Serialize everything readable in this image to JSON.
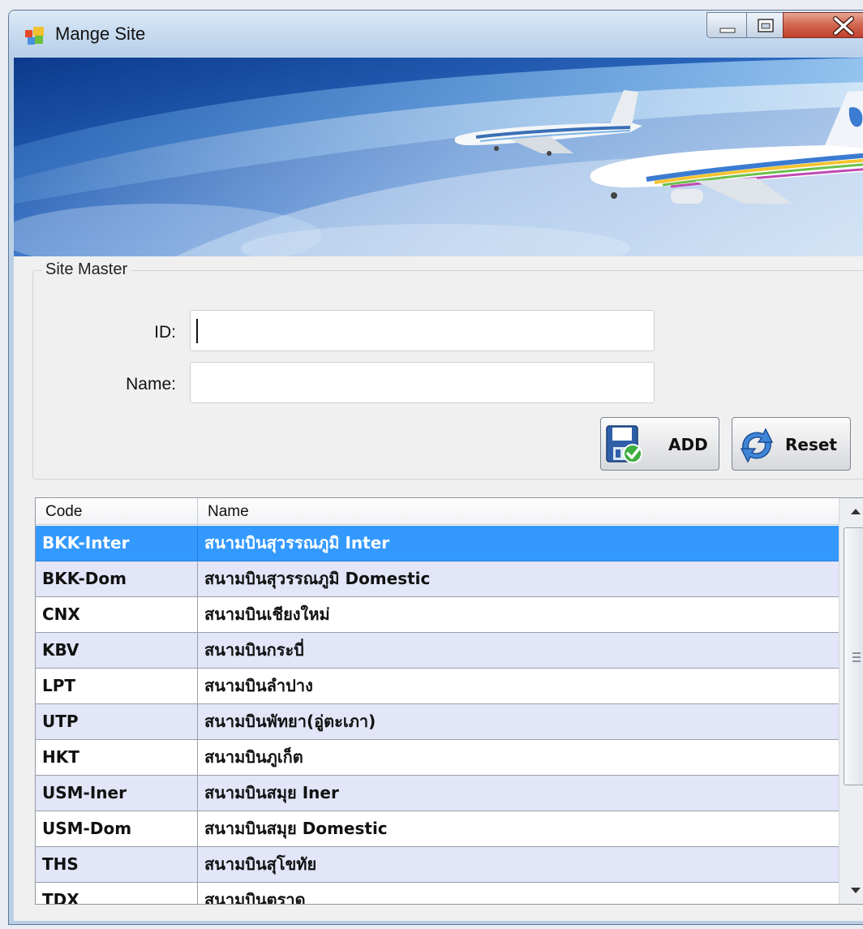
{
  "window": {
    "title": "Mange Site",
    "controls": {
      "minimize": "minimize",
      "maximize": "maximize",
      "close": "close"
    }
  },
  "banner": {
    "image": "airline-banner-two-airplanes"
  },
  "site_master": {
    "group_title": "Site Master",
    "id_label": "ID:",
    "id_value": "",
    "name_label": "Name:",
    "name_value": "",
    "add_label": "ADD",
    "reset_label": "Reset"
  },
  "grid": {
    "columns": [
      "Code",
      "Name"
    ],
    "rows": [
      {
        "code": "BKK-Inter",
        "name": "สนามบินสุวรรณภูมิ Inter"
      },
      {
        "code": "BKK-Dom",
        "name": "สนามบินสุวรรณภูมิ Domestic"
      },
      {
        "code": "CNX",
        "name": "สนามบินเชียงใหม่"
      },
      {
        "code": "KBV",
        "name": "สนามบินกระบี่"
      },
      {
        "code": "LPT",
        "name": "สนามบินลำปาง"
      },
      {
        "code": "UTP",
        "name": "สนามบินพัทยา(อู่ตะเภา)"
      },
      {
        "code": "HKT",
        "name": "สนามบินภูเก็ต"
      },
      {
        "code": "USM-Iner",
        "name": "สนามบินสมุย Iner"
      },
      {
        "code": "USM-Dom",
        "name": "สนามบินสมุย Domestic"
      },
      {
        "code": "THS",
        "name": "สนามบินสุโขทัย"
      },
      {
        "code": "TDX",
        "name": "สนามบินตราด"
      }
    ],
    "selected_index": 0
  },
  "colors": {
    "selection": "#3399ff",
    "row_alt": "#e3e5f8",
    "close_button": "#c1402a"
  }
}
